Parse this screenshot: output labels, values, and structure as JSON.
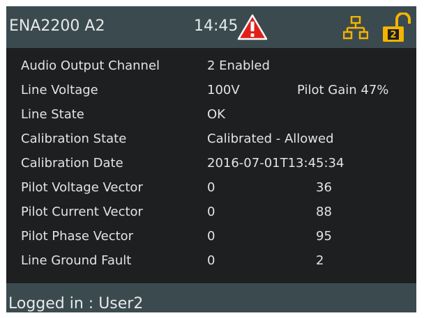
{
  "header": {
    "device_name": "ENA2200 A2",
    "time": "14:45",
    "alarm_icon": "warning-triangle-icon",
    "network_icon": "network-icon",
    "lock_icon": "unlocked-padlock-icon",
    "lock_level": "2",
    "colors": {
      "bar": "#3b4a4f",
      "warning": "#e0201b",
      "icon": "#f4b400"
    }
  },
  "rows": [
    {
      "label": "Audio Output Channel",
      "value": "2 Enabled"
    },
    {
      "label": "Line Voltage",
      "value": "100V",
      "extra": "Pilot Gain 47%"
    },
    {
      "label": "Line State",
      "value": "OK"
    },
    {
      "label": "Calibration State",
      "value": "Calibrated - Allowed"
    },
    {
      "label": "Calibration Date",
      "value": "2016-07-01T13:45:34"
    },
    {
      "label": "Pilot Voltage Vector",
      "value": "0",
      "extra": "36"
    },
    {
      "label": "Pilot Current Vector",
      "value": "0",
      "extra": "88"
    },
    {
      "label": "Pilot Phase Vector",
      "value": "0",
      "extra": "95"
    },
    {
      "label": "Line Ground Fault",
      "value": "0",
      "extra": "2"
    }
  ],
  "footer": {
    "login_text": "Logged in : User2"
  }
}
